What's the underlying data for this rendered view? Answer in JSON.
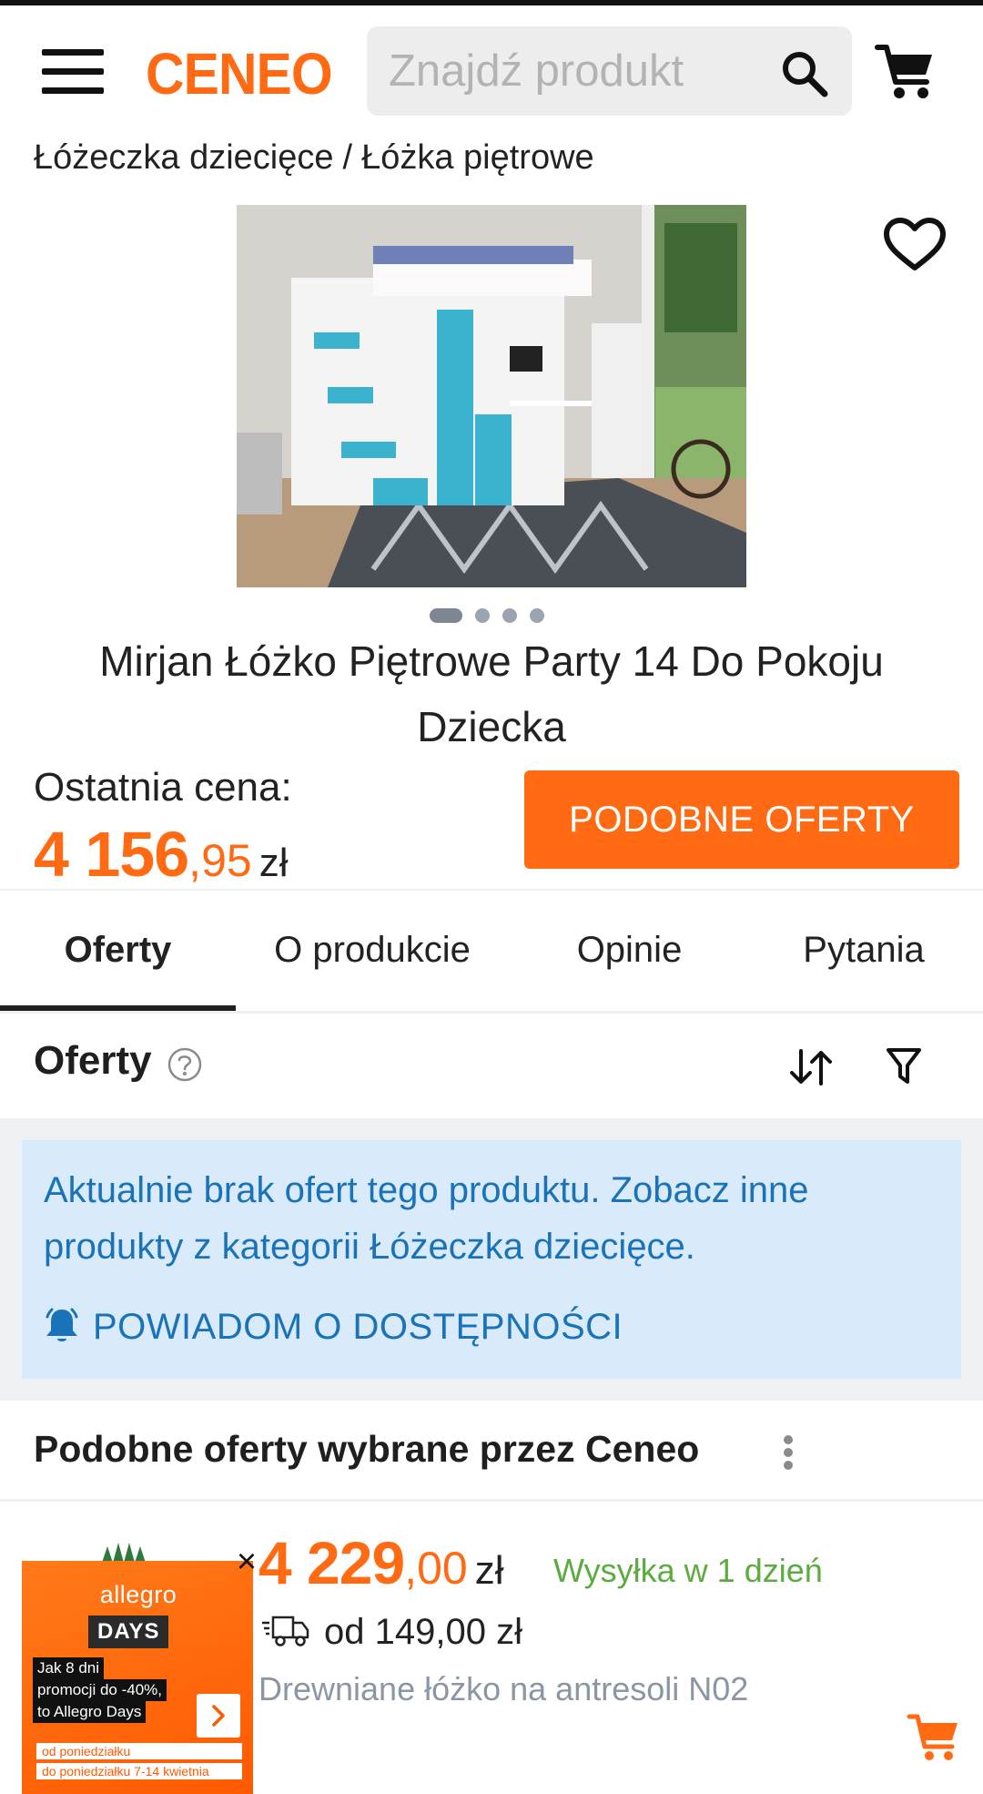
{
  "header": {
    "logo": "CENEO",
    "search_placeholder": "Znajdź produkt",
    "icons": {
      "menu": "hamburger-menu-icon",
      "search": "search-icon",
      "cart": "cart-icon"
    }
  },
  "breadcrumb": {
    "items": [
      "Łóżeczka dziecięce",
      "Łóżka piętrowe"
    ],
    "separator": "/"
  },
  "product": {
    "image_alt_icon": "bunk-bed-photo",
    "favorite_icon": "heart-icon",
    "gallery": {
      "count": 4,
      "active_index": 0
    },
    "title": "Mirjan Łóżko Piętrowe Party 14 Do Pokoju Dziecka",
    "price_label": "Ostatnia cena:",
    "price_whole": "4 156",
    "price_fraction": ",95",
    "currency": "zł",
    "similar_button": "PODOBNE OFERTY"
  },
  "tabs": [
    {
      "label": "Oferty",
      "active": true
    },
    {
      "label": "O produkcie",
      "active": false
    },
    {
      "label": "Opinie",
      "active": false
    },
    {
      "label": "Pytania",
      "active": false
    }
  ],
  "offers": {
    "heading": "Oferty",
    "help_icon": "question-circle-icon",
    "sort_icon": "sort-arrows-icon",
    "filter_icon": "funnel-filter-icon",
    "notice": "Aktualnie brak ofert tego produktu. Zobacz inne produkty z kategorii Łóżeczka dziecięce.",
    "notify_icon": "bell-icon",
    "notify_label": "POWIADOM O DOSTĘPNOŚCI"
  },
  "similar": {
    "heading": "Podobne oferty wybrane przez Ceneo",
    "more_icon": "vertical-dots-icon",
    "offer": {
      "price_whole": "4 229",
      "price_fraction": ",00",
      "currency": "zł",
      "shipping_speed": "Wysyłka w 1 dzień",
      "delivery_icon": "delivery-truck-icon",
      "delivery_price": "od 149,00 zł",
      "name": "Drewniane łóżko na antresoli N02",
      "add_icon": "add-to-cart-icon"
    }
  },
  "ad": {
    "close": "×",
    "brand": "allegro",
    "days": "DAYS",
    "line1": "Jak 8 dni",
    "line2": "promocji do -40%,",
    "line3": "to Allegro Days",
    "foot1": "od poniedziałku",
    "foot2": "do poniedziałku 7-14 kwietnia",
    "arrow_icon": "chevron-right-icon"
  },
  "colors": {
    "brand": "#ff6a13",
    "notice_bg": "#d9ebfb",
    "notice_text": "#1a73b8",
    "shipping_green": "#5bab3e"
  }
}
